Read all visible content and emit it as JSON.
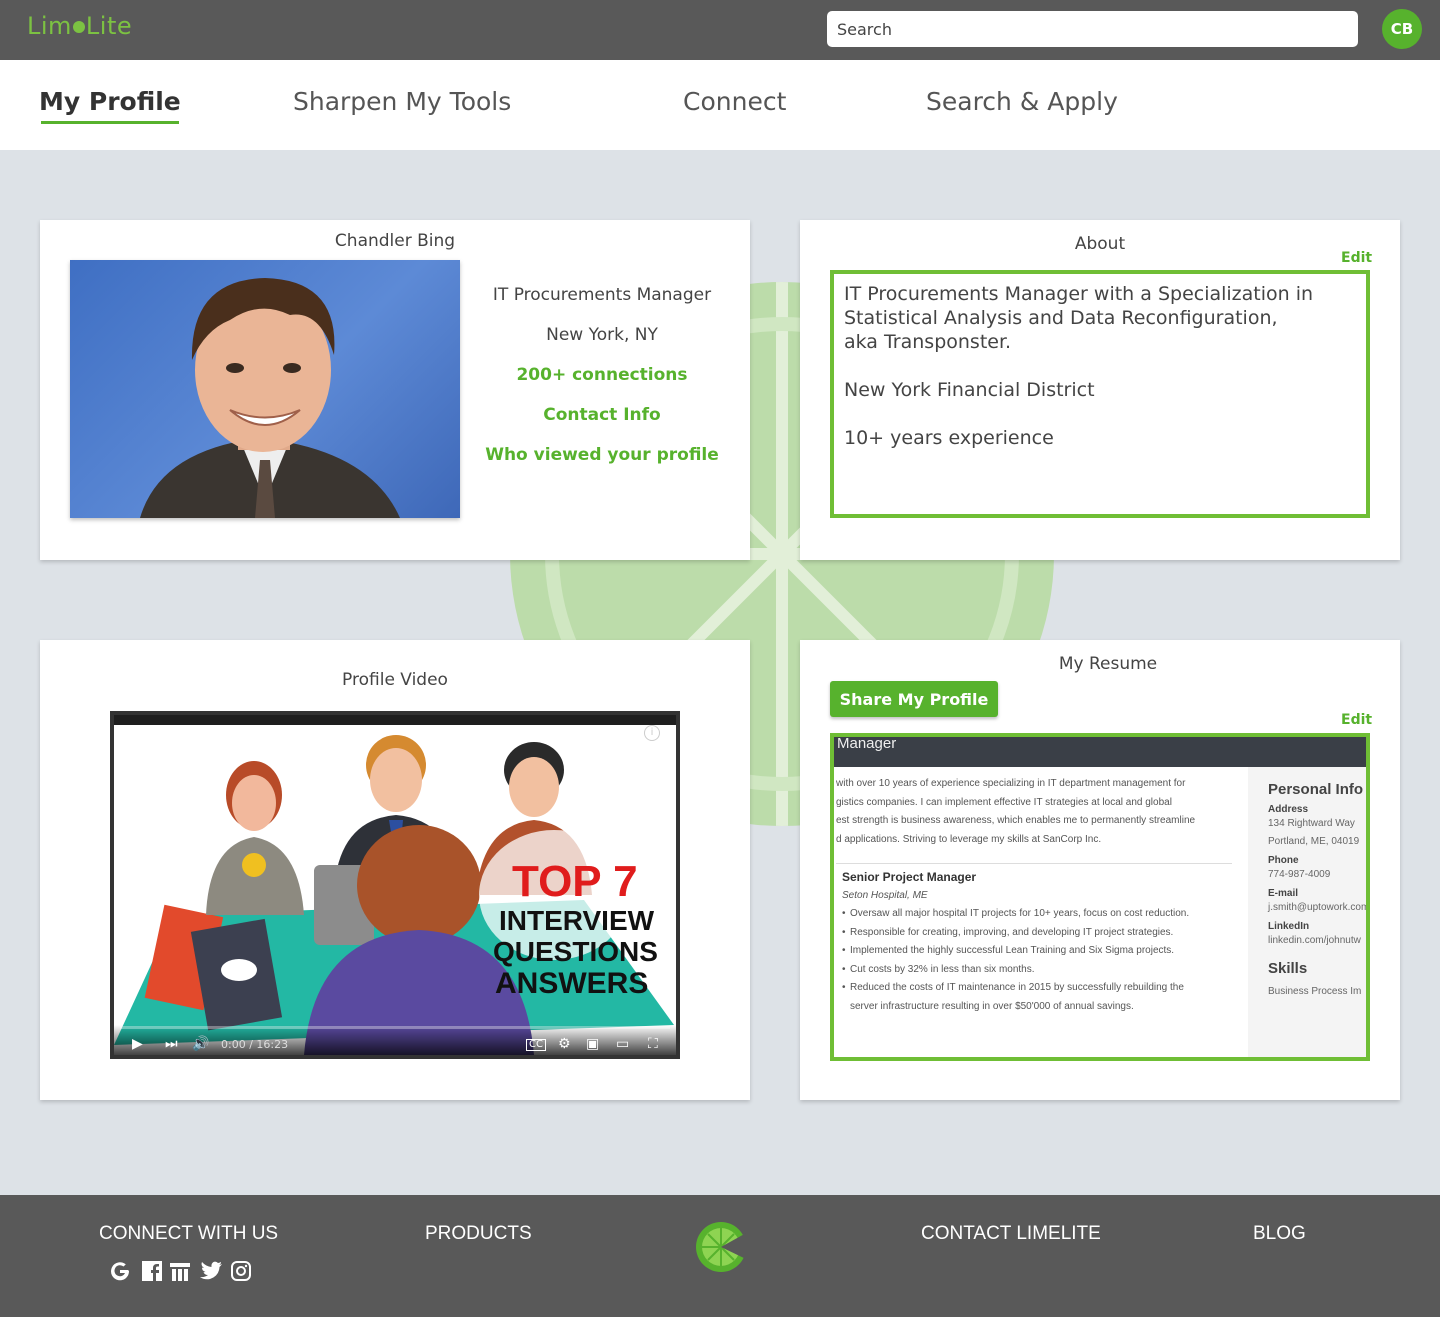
{
  "brand": {
    "name_part1": "Lim",
    "name_part2": "Lite"
  },
  "search": {
    "placeholder": "Search"
  },
  "user": {
    "initials": "CB"
  },
  "nav": {
    "items": [
      {
        "label": "My Profile",
        "active": true
      },
      {
        "label": "Sharpen My Tools"
      },
      {
        "label": "Connect"
      },
      {
        "label": "Search & Apply"
      }
    ]
  },
  "profile": {
    "name": "Chandler Bing",
    "title": "IT Procurements Manager",
    "location": "New York, NY",
    "connections": "200+ connections",
    "contact": "Contact Info",
    "viewers": "Who viewed your profile"
  },
  "about": {
    "title": "About",
    "edit": "Edit",
    "paragraphs": [
      "IT Procurements Manager with a Specialization in\nStatistical Analysis and Data Reconfiguration,\naka Transponster.",
      "New York Financial District",
      "10+ years experience"
    ]
  },
  "video": {
    "title": "Profile Video",
    "overlay_top": "TOP 7",
    "overlay_lines": [
      "INTERVIEW",
      "QUESTIONS",
      "ANSWERS"
    ],
    "time": "0:00 / 16:23",
    "progress": 0
  },
  "resume": {
    "title": "My Resume",
    "share_label": "Share My Profile",
    "edit": "Edit",
    "header_text": "Manager",
    "summary_lines": [
      "with over 10 years of experience specializing in IT department management for",
      "gistics companies. I can implement effective IT strategies at local and global",
      "est strength is business awareness, which enables me to permanently streamline",
      "d applications. Striving to leverage my skills at SanCorp Inc."
    ],
    "job_title": "Senior Project Manager",
    "job_location": "Seton Hospital, ME",
    "bullets": [
      "Oversaw all major hospital IT projects for 10+ years, focus on cost reduction.",
      "Responsible for creating, improving, and developing IT project strategies.",
      "Implemented the highly successful Lean Training and Six Sigma projects.",
      "Cut costs by 32% in less than six months.",
      "Reduced the costs of IT maintenance in 2015 by successfully rebuilding the",
      "server infrastructure resulting in over $50'000 of annual savings."
    ],
    "personal_info_title": "Personal Info",
    "address_label": "Address",
    "address_line1": "134 Rightward Way",
    "address_line2": "Portland, ME, 04019",
    "phone_label": "Phone",
    "phone": "774-987-4009",
    "email_label": "E-mail",
    "email": "j.smith@uptowork.com",
    "linkedin_label": "LinkedIn",
    "linkedin": "linkedin.com/johnutw",
    "skills_title": "Skills",
    "skill1": "Business Process Im"
  },
  "footer": {
    "connect": "CONNECT WITH US",
    "products": "PRODUCTS",
    "contact": "CONTACT LIMELITE",
    "blog": "BLOG",
    "social_icons": [
      "google-icon",
      "facebook-icon",
      "linkedin-icon",
      "twitter-icon",
      "instagram-icon"
    ]
  },
  "colors": {
    "accent": "#57b22d",
    "topbar": "#595959",
    "background": "#dde2e7"
  }
}
